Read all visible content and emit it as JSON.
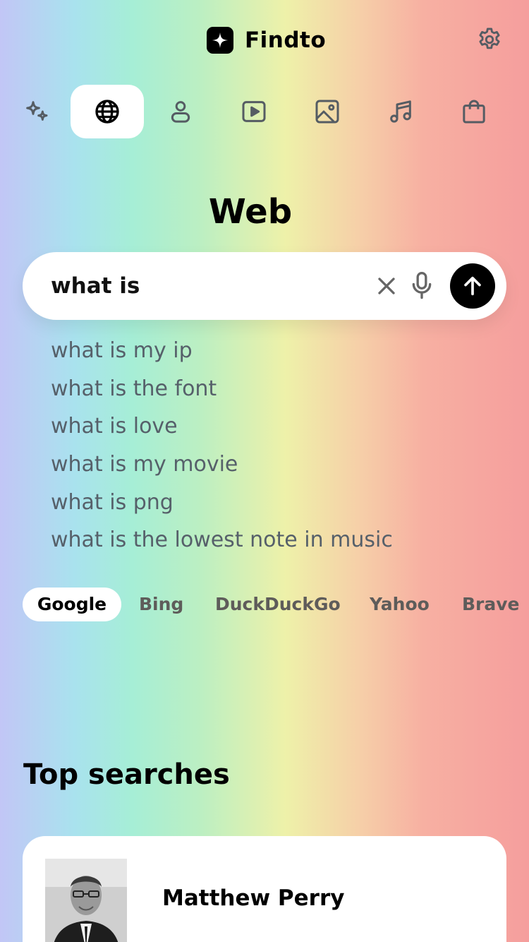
{
  "app": {
    "name": "Findto"
  },
  "header": {
    "settings_icon": "gear-icon"
  },
  "tabs": [
    {
      "id": "ai",
      "icon": "sparkles-icon",
      "active": false
    },
    {
      "id": "web",
      "icon": "globe-icon",
      "active": true
    },
    {
      "id": "people",
      "icon": "user-icon",
      "active": false
    },
    {
      "id": "videos",
      "icon": "play-icon",
      "active": false
    },
    {
      "id": "images",
      "icon": "image-icon",
      "active": false
    },
    {
      "id": "music",
      "icon": "music-icon",
      "active": false
    },
    {
      "id": "shopping",
      "icon": "bag-icon",
      "active": false
    }
  ],
  "page": {
    "title": "Web"
  },
  "search": {
    "value": "what is",
    "placeholder": ""
  },
  "suggestions": [
    "what is my ip",
    "what is the font",
    "what is love",
    "what is my movie",
    "what is png",
    "what is the lowest note in music"
  ],
  "engines": [
    {
      "label": "Google",
      "active": true
    },
    {
      "label": "Bing",
      "active": false
    },
    {
      "label": "DuckDuckGo",
      "active": false
    },
    {
      "label": "Yahoo",
      "active": false
    },
    {
      "label": "Brave",
      "active": false
    }
  ],
  "top_searches": {
    "title": "Top searches",
    "items": [
      {
        "name": "Matthew Perry"
      }
    ]
  },
  "colors": {
    "accent": "#000000",
    "suggestion_text": "#56606a",
    "icon": "#555c63"
  }
}
